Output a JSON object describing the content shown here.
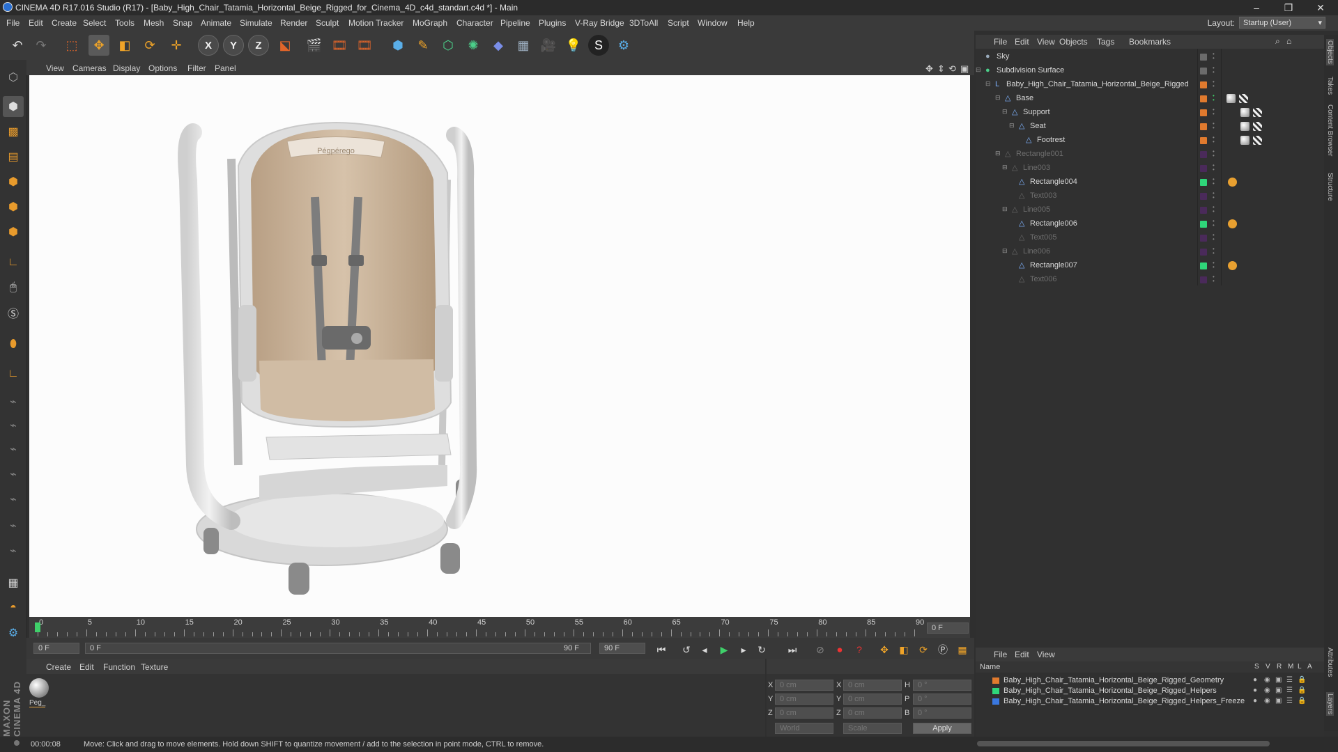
{
  "window": {
    "title": "CINEMA 4D R17.016 Studio (R17) - [Baby_High_Chair_Tatamia_Horizontal_Beige_Rigged_for_Cinema_4D_c4d_standart.c4d *] - Main",
    "minimize": "–",
    "restore": "❐",
    "close": "✕"
  },
  "menubar": {
    "items": [
      "File",
      "Edit",
      "Create",
      "Select",
      "Tools",
      "Mesh",
      "Snap",
      "Animate",
      "Simulate",
      "Render",
      "Sculpt",
      "Motion Tracker",
      "MoGraph",
      "Character",
      "Pipeline",
      "Plugins",
      "V-Ray Bridge",
      "3DToAll",
      "Script",
      "Window",
      "Help"
    ],
    "layout_label": "Layout:",
    "layout_value": "Startup (User)"
  },
  "toolbar": {
    "axis_x": "X",
    "axis_y": "Y",
    "axis_z": "Z"
  },
  "viewport": {
    "menu": [
      "View",
      "Cameras",
      "Display",
      "Options",
      "Filter",
      "Panel"
    ],
    "headrest_label": "Pégpérego"
  },
  "timeline": {
    "ticks": [
      0,
      5,
      10,
      15,
      20,
      25,
      30,
      35,
      40,
      45,
      50,
      55,
      60,
      65,
      70,
      75,
      80,
      85,
      90
    ],
    "current_frame": "0 F",
    "start_field": "0 F",
    "range_start": "0 F",
    "range_end": "90 F",
    "end_field": "90 F"
  },
  "material_manager": {
    "menu": [
      "Create",
      "Edit",
      "Function",
      "Texture"
    ],
    "materials": [
      {
        "name": "Peg_"
      }
    ]
  },
  "coordinates": {
    "pos_labels": [
      "X",
      "Y",
      "Z"
    ],
    "size_labels": [
      "X",
      "Y",
      "Z"
    ],
    "rot_labels": [
      "H",
      "P",
      "B"
    ],
    "pos_values": [
      "0 cm",
      "0 cm",
      "0 cm"
    ],
    "size_values": [
      "0 cm",
      "0 cm",
      "0 cm"
    ],
    "rot_values": [
      "0 °",
      "0 °",
      "0 °"
    ],
    "mode1": "World",
    "mode2": "Scale",
    "apply": "Apply"
  },
  "object_manager": {
    "menu": [
      "File",
      "Edit",
      "View",
      "Objects",
      "Tags",
      "Bookmarks"
    ],
    "objects": [
      {
        "name": "Sky",
        "dim": false,
        "color": "#6b6b6b"
      },
      {
        "name": "Subdivision Surface",
        "dim": false,
        "color": "#6b6b6b"
      },
      {
        "name": "Baby_High_Chair_Tatamia_Horizontal_Beige_Rigged",
        "dim": false,
        "color": "#e07a2e"
      },
      {
        "name": "Base",
        "dim": false,
        "color": "#e07a2e"
      },
      {
        "name": "Support",
        "dim": false,
        "color": "#e07a2e"
      },
      {
        "name": "Seat",
        "dim": false,
        "color": "#e07a2e"
      },
      {
        "name": "Footrest",
        "dim": false,
        "color": "#e07a2e"
      },
      {
        "name": "Rectangle001",
        "dim": true,
        "color": "#4a2a5a"
      },
      {
        "name": "Line003",
        "dim": true,
        "color": "#4a2a5a"
      },
      {
        "name": "Rectangle004",
        "dim": false,
        "color": "#2fd67a"
      },
      {
        "name": "Text003",
        "dim": true,
        "color": "#4a2a5a"
      },
      {
        "name": "Line005",
        "dim": true,
        "color": "#4a2a5a"
      },
      {
        "name": "Rectangle006",
        "dim": false,
        "color": "#2fd67a"
      },
      {
        "name": "Text005",
        "dim": true,
        "color": "#4a2a5a"
      },
      {
        "name": "Line006",
        "dim": true,
        "color": "#4a2a5a"
      },
      {
        "name": "Rectangle007",
        "dim": false,
        "color": "#2fd67a"
      },
      {
        "name": "Text006",
        "dim": true,
        "color": "#4a2a5a"
      }
    ]
  },
  "right_tabs": [
    "Objects",
    "Takes",
    "Content Browser",
    "Structure",
    "Attributes",
    "Layers"
  ],
  "layer_manager": {
    "menu": [
      "File",
      "Edit",
      "View"
    ],
    "col_name": "Name",
    "cols": [
      "S",
      "V",
      "R",
      "M",
      "L",
      "A"
    ],
    "layers": [
      {
        "name": "Baby_High_Chair_Tatamia_Horizontal_Beige_Rigged_Geometry",
        "color": "#e07a2e"
      },
      {
        "name": "Baby_High_Chair_Tatamia_Horizontal_Beige_Rigged_Helpers",
        "color": "#2fd67a"
      },
      {
        "name": "Baby_High_Chair_Tatamia_Horizontal_Beige_Rigged_Helpers_Freeze",
        "color": "#3a78e0"
      }
    ]
  },
  "statusbar": {
    "time": "00:00:08",
    "message": "Move: Click and drag to move elements. Hold down SHIFT to quantize movement / add to the selection in point mode, CTRL to remove."
  },
  "branding": {
    "logo": "MAXON CINEMA 4D"
  }
}
